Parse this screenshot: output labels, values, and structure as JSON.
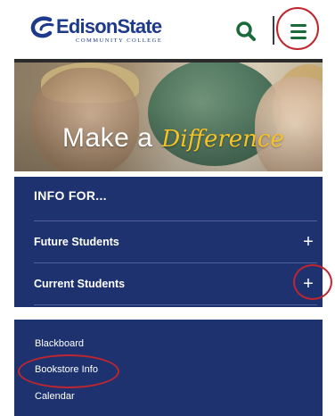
{
  "header": {
    "logo_name": "EdisonState",
    "logo_sub": "COMMUNITY COLLEGE",
    "search_icon": "search-icon",
    "menu_icon": "hamburger-menu-icon"
  },
  "hero": {
    "text_plain": "Make a",
    "text_script": "Difference"
  },
  "info": {
    "heading": "INFO FOR...",
    "items": [
      {
        "label": "Future Students",
        "icon": "plus-icon"
      },
      {
        "label": "Current Students",
        "icon": "plus-icon"
      }
    ]
  },
  "links": {
    "items": [
      {
        "label": "Blackboard"
      },
      {
        "label": "Bookstore Info"
      },
      {
        "label": "Calendar"
      }
    ]
  },
  "colors": {
    "brand_blue": "#1e3a8a",
    "panel_navy": "#1e3270",
    "accent_green": "#1b6b3a",
    "accent_gold": "#f6c325",
    "annotation_red": "#c0262d"
  }
}
